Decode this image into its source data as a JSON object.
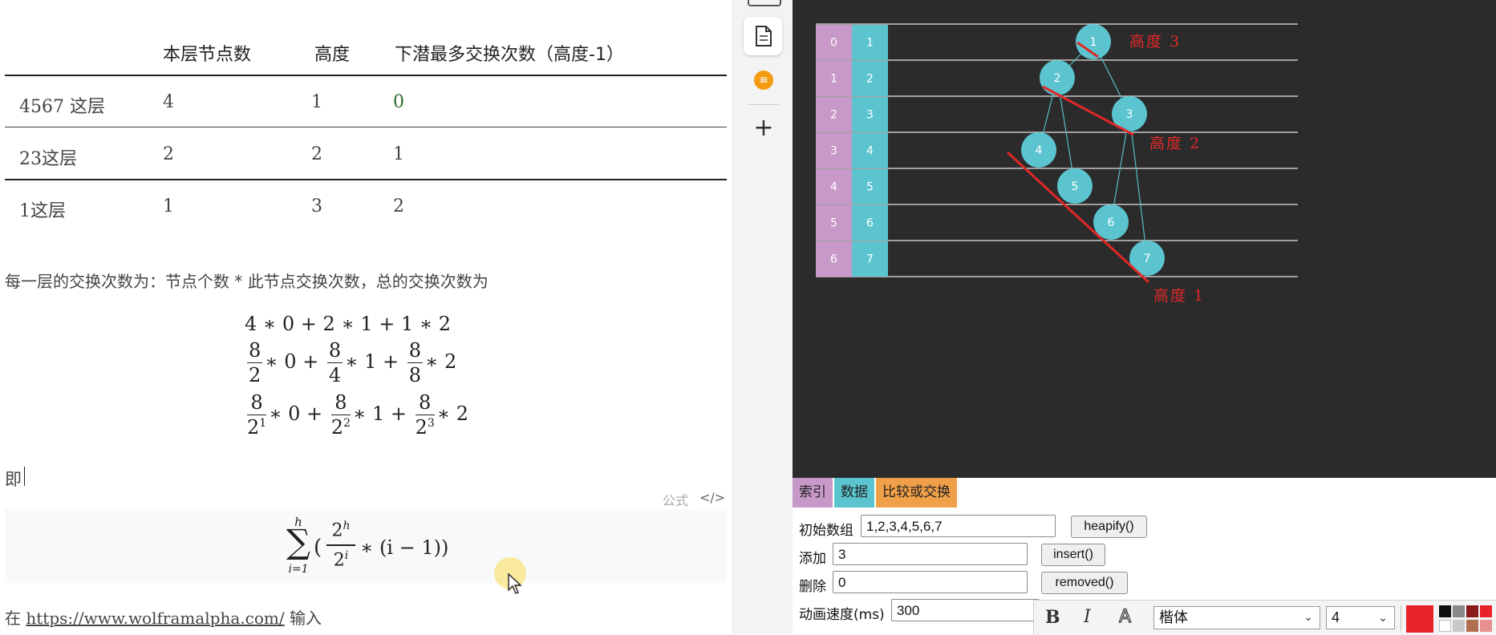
{
  "table": {
    "headers": [
      "本层节点数",
      "高度",
      "下潜最多交换次数（高度-1）"
    ],
    "rows": [
      {
        "name": "4567 这层",
        "count": "4",
        "height": "1",
        "swaps": "0"
      },
      {
        "name": "23这层",
        "count": "2",
        "height": "2",
        "swaps": "1"
      },
      {
        "name": "1这层",
        "count": "1",
        "height": "3",
        "swaps": "2"
      }
    ]
  },
  "paragraph": "每一层的交换次数为：节点个数 * 此节点交换次数，总的交换次数为",
  "math": {
    "line1": "4 ∗ 0 + 2 ∗ 1 + 1 ∗ 2",
    "numerator": "8",
    "denoms_line2": [
      "2",
      "4",
      "8"
    ],
    "multipliers": [
      "∗ 0 +",
      "∗ 1 +",
      "∗ 2"
    ],
    "exps_line3": [
      "1",
      "2",
      "3"
    ],
    "sum_upper": "h",
    "sum_lower": "i=1",
    "sum_num": "2",
    "sum_num_exp": "h",
    "sum_den": "2",
    "sum_den_exp": "i",
    "sum_tail": "∗ (i − 1))",
    "sum_open": "("
  },
  "ji_label": "即",
  "formula_tag": "公式",
  "code_tag": "</>",
  "footer": {
    "prefix": "在",
    "link": "https://www.wolframalpha.com/",
    "suffix": "输入"
  },
  "viz": {
    "indices": [
      "0",
      "1",
      "2",
      "3",
      "4",
      "5",
      "6"
    ],
    "values": [
      "1",
      "2",
      "3",
      "4",
      "5",
      "6",
      "7"
    ],
    "nodes": [
      "1",
      "2",
      "3",
      "4",
      "5",
      "6",
      "7"
    ],
    "annotations": [
      "高度 3",
      "高度 2",
      "高度 1"
    ],
    "colors": {
      "index": "#c898c8",
      "value": "#5bc4cf",
      "node": "#5bc4cf",
      "annotation": "#e02828",
      "line": "#e6e6e6"
    }
  },
  "panel": {
    "tags": [
      "索引",
      "数据",
      "比较或交换"
    ],
    "tag_colors": [
      "#c898c8",
      "#5bc4cf",
      "#f0a048"
    ],
    "init_label": "初始数组",
    "init_value": "1,2,3,4,5,6,7",
    "heapify_btn": "heapify()",
    "add_label": "添加",
    "add_value": "3",
    "insert_btn": "insert()",
    "del_label": "删除",
    "del_value": "0",
    "removed_btn": "removed()",
    "speed_label": "动画速度(ms)",
    "speed_value": "300"
  },
  "fmt": {
    "bold": "B",
    "italic": "I",
    "outline": "A",
    "font": "楷体",
    "size": "4"
  }
}
